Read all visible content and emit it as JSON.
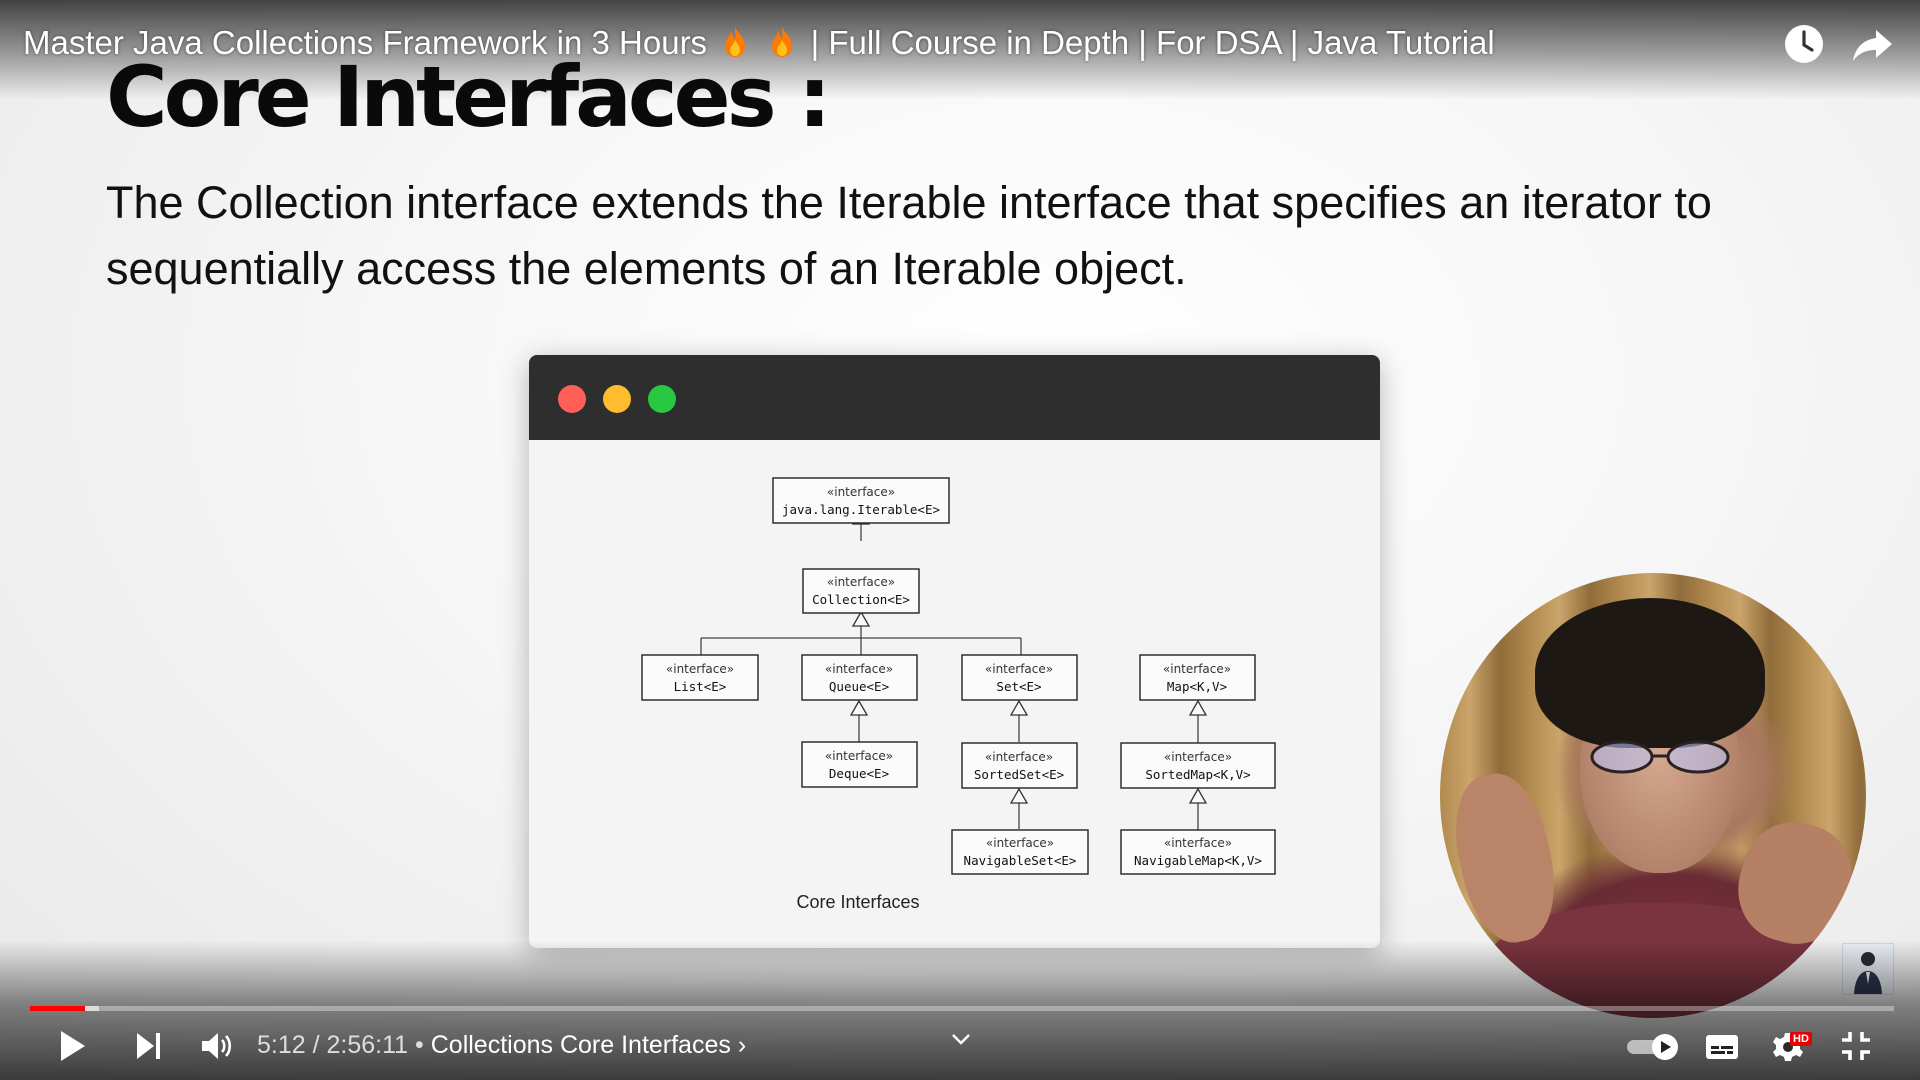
{
  "player": {
    "title_part1": "Master Java Collections Framework in 3 Hours",
    "title_part2": "| Full Course in Depth | For DSA | Java Tutorial",
    "icons": {
      "flame": "fire-emoji",
      "watch_later": "clock-icon",
      "share": "share-icon"
    }
  },
  "slide": {
    "heading": "Core Interfaces :",
    "body": "The Collection interface extends the Iterable interface that specifies an iterator to sequentially access the elements of an Iterable object."
  },
  "window": {
    "dots": [
      "#ff5f57",
      "#febc2e",
      "#28c840"
    ],
    "titlebar_color": "#2e2e2e"
  },
  "diagram": {
    "stereotype": "«interface»",
    "nodes": {
      "iterable": "java.lang.Iterable<E>",
      "collection": "Collection<E>",
      "list": "List<E>",
      "queue": "Queue<E>",
      "set": "Set<E>",
      "map": "Map<K,V>",
      "deque": "Deque<E>",
      "sortedset": "SortedSet<E>",
      "sortedmap": "SortedMap<K,V>",
      "navigableset": "NavigableSet<E>",
      "navigablemap": "NavigableMap<K,V>"
    },
    "caption": "Core Interfaces"
  },
  "controls": {
    "time_current": "5:12",
    "time_separator": " / ",
    "time_total": "2:56:11",
    "chapter_separator": " • ",
    "chapter": "Collections Core Interfaces",
    "chapter_arrow": "›",
    "progress_fraction": 0.0294,
    "buffered_fraction": 0.037,
    "hd_label": "HD",
    "accent_color": "#ff0000",
    "icons": {
      "play": "play-icon",
      "next": "next-icon",
      "volume": "volume-icon",
      "expand": "chevron-down-icon",
      "autoplay": "autoplay-toggle",
      "captions": "subtitles-icon",
      "settings": "gear-icon",
      "fullscreen": "exit-fullscreen-icon"
    }
  }
}
